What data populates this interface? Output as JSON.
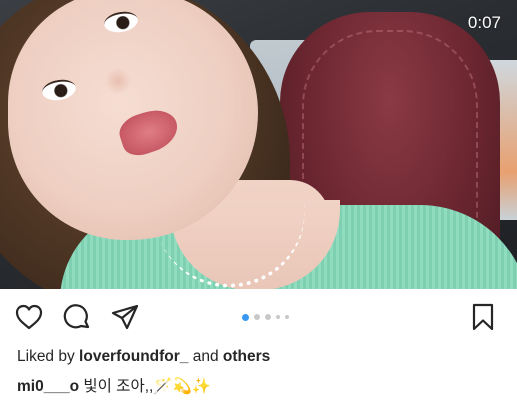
{
  "media": {
    "timer": "0:07",
    "carousel": {
      "count": 5,
      "active_index": 0
    }
  },
  "actions": {
    "like_icon": "heart-icon",
    "comment_icon": "comment-bubble-icon",
    "share_icon": "paper-plane-icon",
    "save_icon": "bookmark-icon"
  },
  "likes": {
    "prefix": "Liked by",
    "user": "loverfoundfor_",
    "conjunction": "and",
    "others": "others"
  },
  "caption": {
    "username": "mi0___o",
    "text": "빛이 조아,,🪄💫✨"
  },
  "colors": {
    "accent": "#3897f0",
    "text": "#262626",
    "sweater": "#8fdcbf",
    "seat": "#6b2630"
  }
}
